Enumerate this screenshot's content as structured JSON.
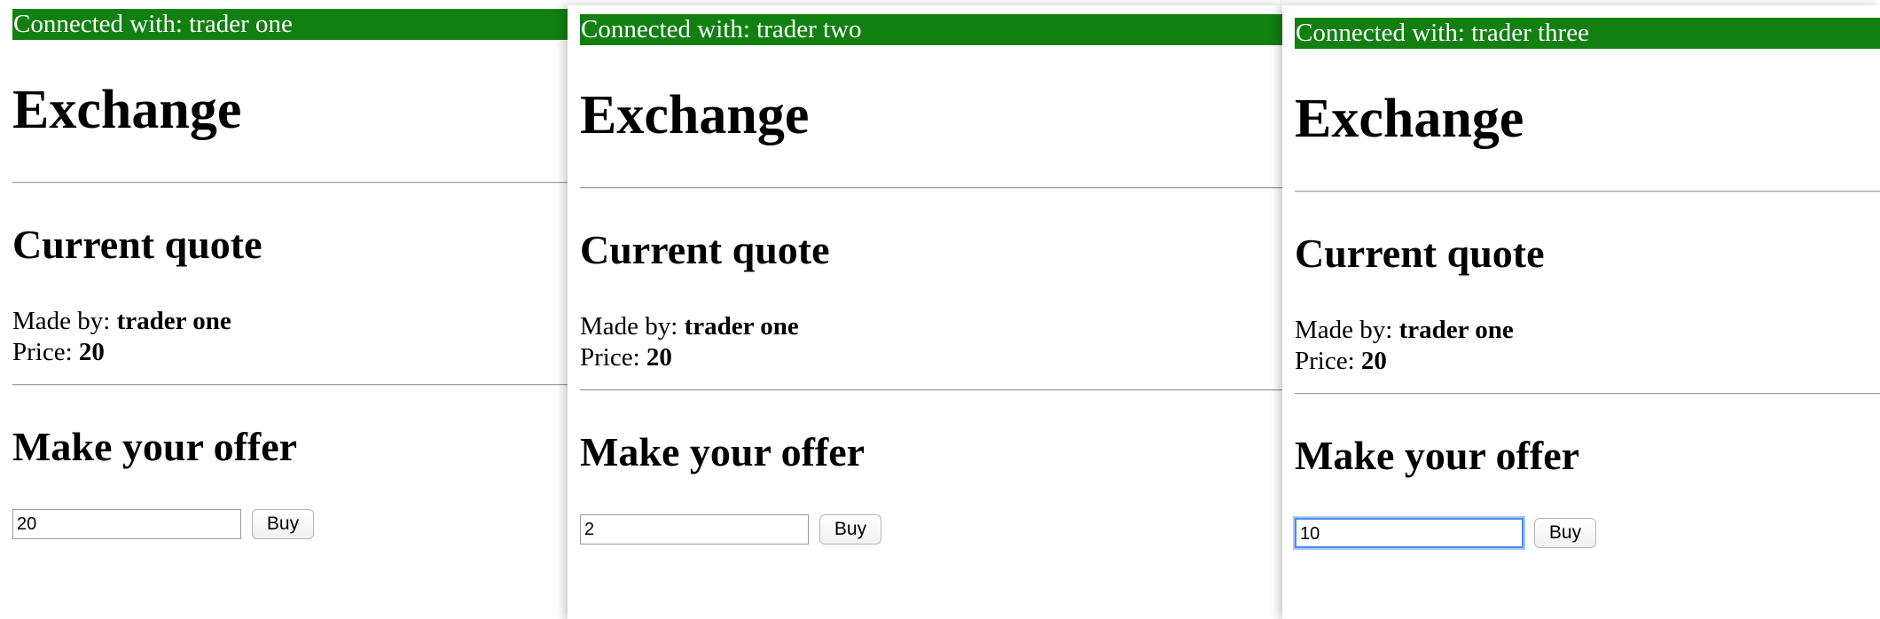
{
  "windows": [
    {
      "banner": "Connected with: trader one",
      "title": "Exchange",
      "quote_heading": "Current quote",
      "made_by_label": "Made by: ",
      "made_by_value": "trader one",
      "price_label": "Price: ",
      "price_value": "20",
      "offer_heading": "Make your offer",
      "offer_value": "20",
      "buy_label": "Buy"
    },
    {
      "banner": "Connected with: trader two",
      "title": "Exchange",
      "quote_heading": "Current quote",
      "made_by_label": "Made by: ",
      "made_by_value": "trader one",
      "price_label": "Price: ",
      "price_value": "20",
      "offer_heading": "Make your offer",
      "offer_value": "2",
      "buy_label": "Buy"
    },
    {
      "banner": "Connected with: trader three",
      "title": "Exchange",
      "quote_heading": "Current quote",
      "made_by_label": "Made by: ",
      "made_by_value": "trader one",
      "price_label": "Price: ",
      "price_value": "20",
      "offer_heading": "Make your offer",
      "offer_value": "10",
      "buy_label": "Buy"
    }
  ],
  "colors": {
    "banner_bg": "#118011",
    "banner_text": "#ffffff",
    "focus_ring": "#4a8af4"
  }
}
